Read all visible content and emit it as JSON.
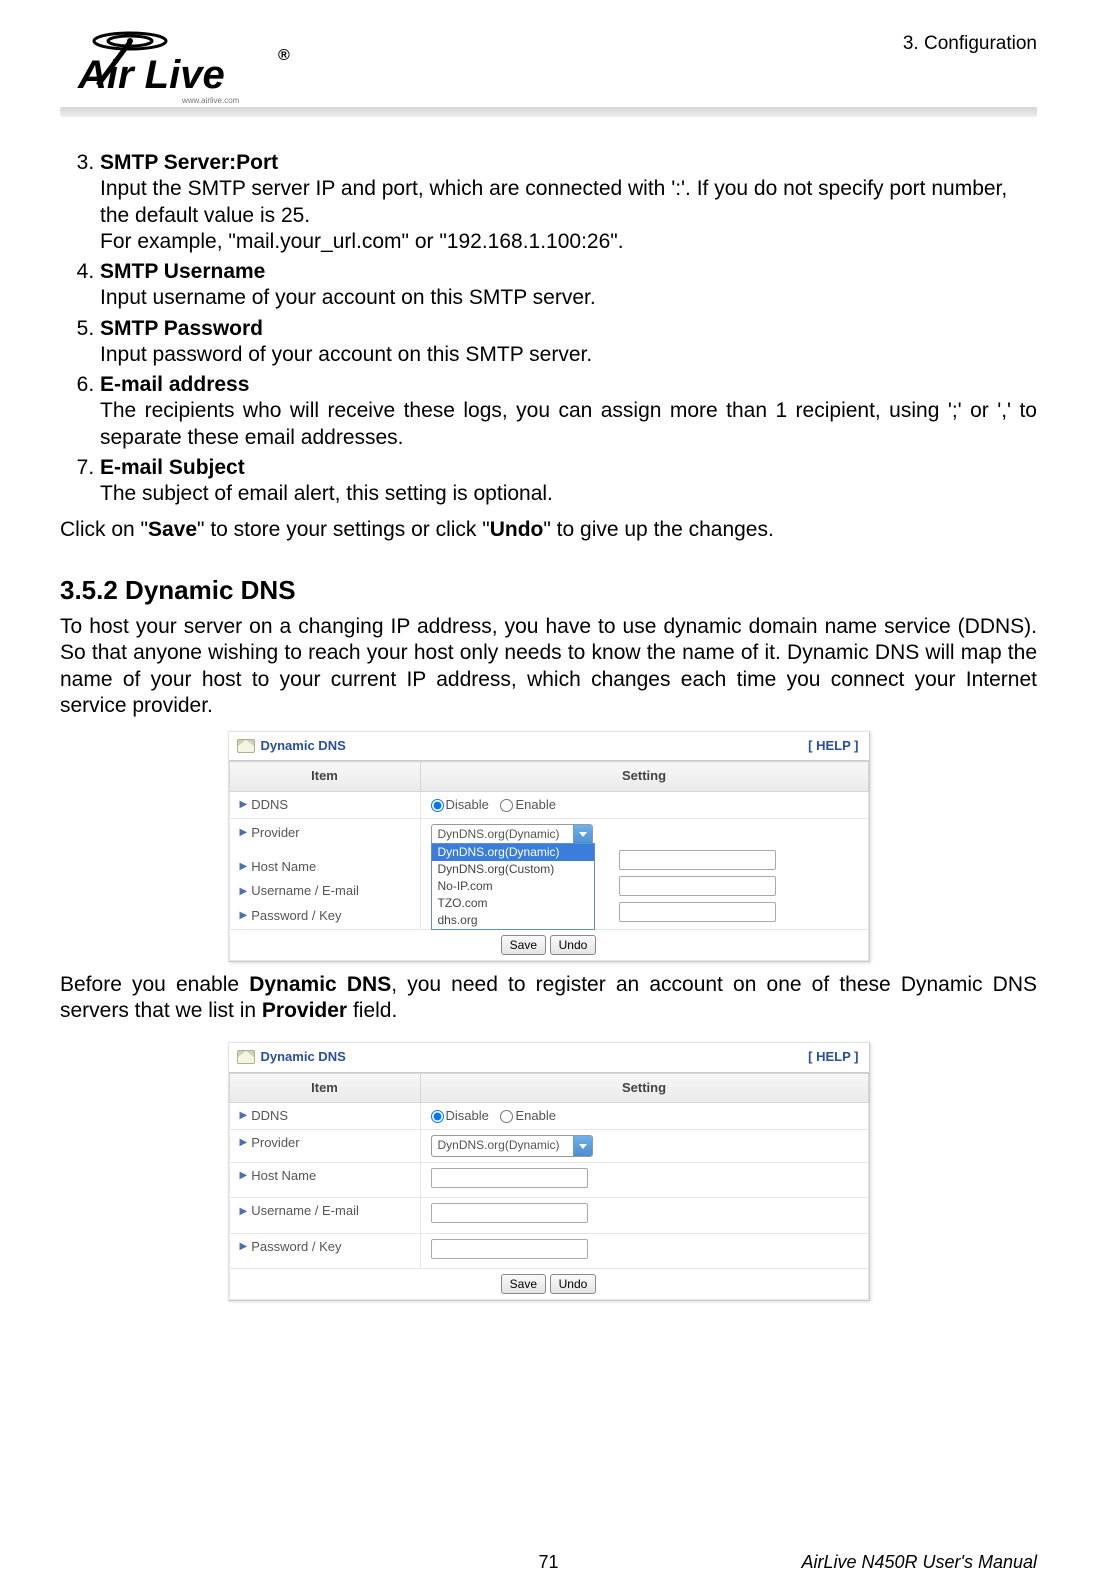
{
  "header": {
    "chapter": "3.  Configuration",
    "logo_text_top": "Air Live",
    "logo_reg": "®",
    "logo_sub": "www.airlive.com"
  },
  "list": {
    "start": 3,
    "items": [
      {
        "title": "SMTP Server:Port",
        "body": "Input the SMTP server IP and port, which are connected with ':'. If you do not specify port number, the default value is 25.",
        "body2": "For example, \"mail.your_url.com\" or \"192.168.1.100:26\"."
      },
      {
        "title": "SMTP Username",
        "body": "Input username of your account on this SMTP server."
      },
      {
        "title": "SMTP Password",
        "body": "Input password of your account on this SMTP server."
      },
      {
        "title": "E-mail address",
        "body": "The recipients who will receive these logs, you can assign more than 1 recipient, using ';' or ',' to separate these email addresses."
      },
      {
        "title": "E-mail Subject",
        "body": "The subject of email alert, this setting is optional."
      }
    ]
  },
  "save_line": {
    "pre": "Click on \"",
    "save": "Save",
    "mid": "\" to store your settings or click \"",
    "undo": "Undo",
    "suf": "\" to give up the changes."
  },
  "section_heading": "3.5.2 Dynamic DNS",
  "intro_para": "To host your server on a changing IP address, you have to use dynamic domain name service (DDNS). So that anyone wishing to reach your host only needs to know the name of it. Dynamic DNS will map the name of your host to your current IP address, which changes each time you connect your Internet service provider.",
  "before_para": {
    "pre": "Before you enable ",
    "b1": "Dynamic DNS",
    "mid": ", you need to register an account on one of these Dynamic DNS servers that we list in ",
    "b2": "Provider",
    "suf": " field."
  },
  "ui1": {
    "title": "Dynamic DNS",
    "help": "[ HELP ]",
    "col_item": "Item",
    "col_setting": "Setting",
    "rows": {
      "ddns": "DDNS",
      "provider": "Provider",
      "host": "Host Name",
      "user": "Username / E-mail",
      "pass": "Password / Key"
    },
    "radio_disable": "Disable",
    "radio_enable": "Enable",
    "dd_selected": "DynDNS.org(Dynamic)",
    "dd_options": [
      "DynDNS.org(Dynamic)",
      "DynDNS.org(Custom)",
      "No-IP.com",
      "TZO.com",
      "dhs.org"
    ],
    "btn_save": "Save",
    "btn_undo": "Undo"
  },
  "ui2": {
    "title": "Dynamic DNS",
    "help": "[ HELP ]",
    "col_item": "Item",
    "col_setting": "Setting",
    "rows": {
      "ddns": "DDNS",
      "provider": "Provider",
      "host": "Host Name",
      "user": "Username / E-mail",
      "pass": "Password / Key"
    },
    "radio_disable": "Disable",
    "radio_enable": "Enable",
    "dd_selected": "DynDNS.org(Dynamic)",
    "btn_save": "Save",
    "btn_undo": "Undo"
  },
  "footer": {
    "page": "71",
    "manual": "AirLive N450R User's Manual"
  }
}
